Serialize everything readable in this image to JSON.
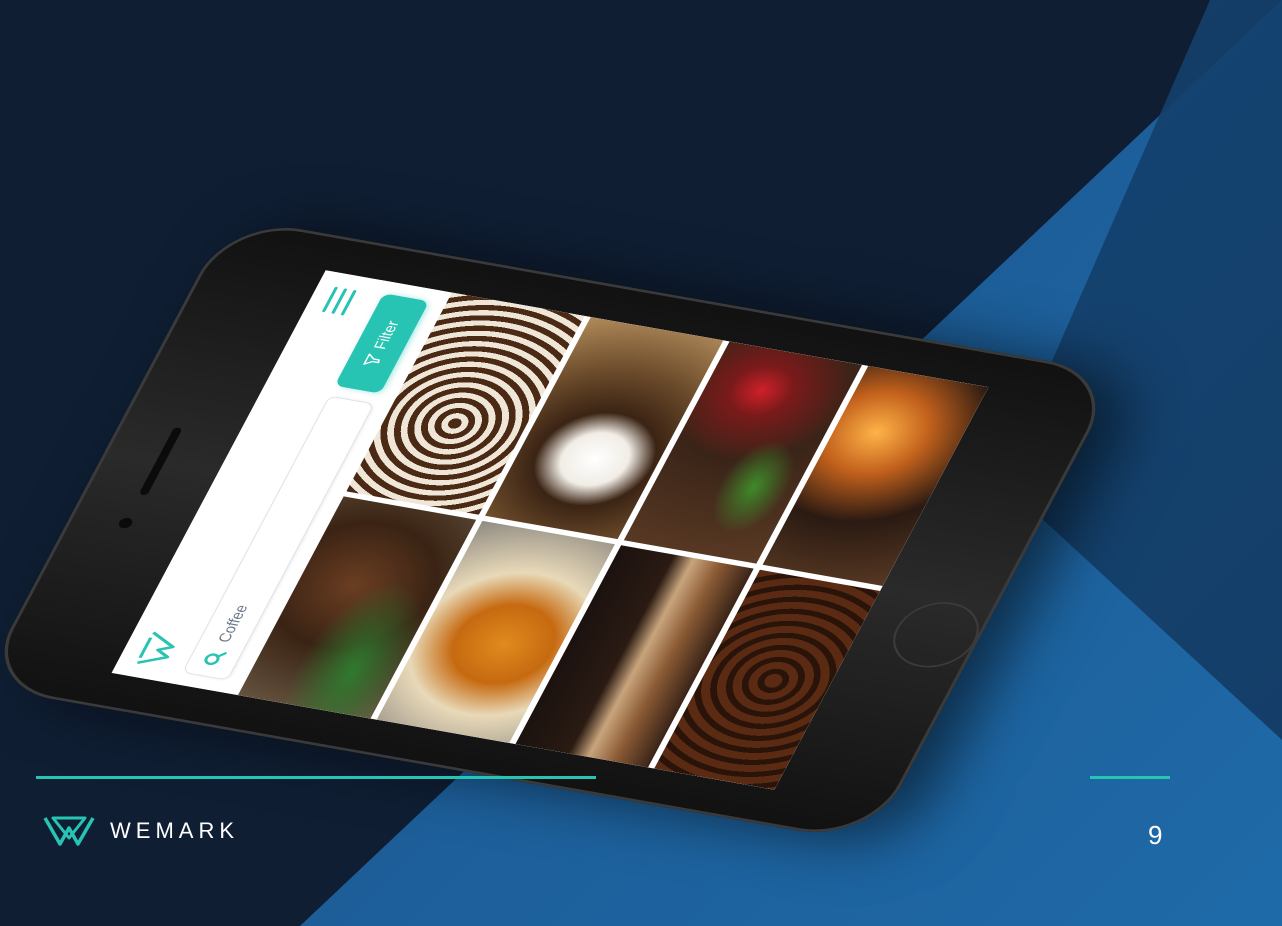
{
  "app": {
    "search": {
      "value": "Coffee"
    },
    "filter_button": {
      "label": "Filter"
    },
    "photos": [
      {
        "name": "coffee-beans-on-wood"
      },
      {
        "name": "coffee-beans-pattern"
      },
      {
        "name": "espresso-in-glass"
      },
      {
        "name": "espresso-cup-beans-sack"
      },
      {
        "name": "latte-glass"
      },
      {
        "name": "coffee-grinder-red-cup"
      },
      {
        "name": "roasted-beans-bowl"
      },
      {
        "name": "cup-by-fireplace"
      }
    ]
  },
  "footer": {
    "brand_name": "WEMARK",
    "page_number": "9"
  },
  "colors": {
    "accent": "#27c4b4",
    "background_dark": "#0f1e33",
    "background_blue": "#1e6aa8"
  }
}
